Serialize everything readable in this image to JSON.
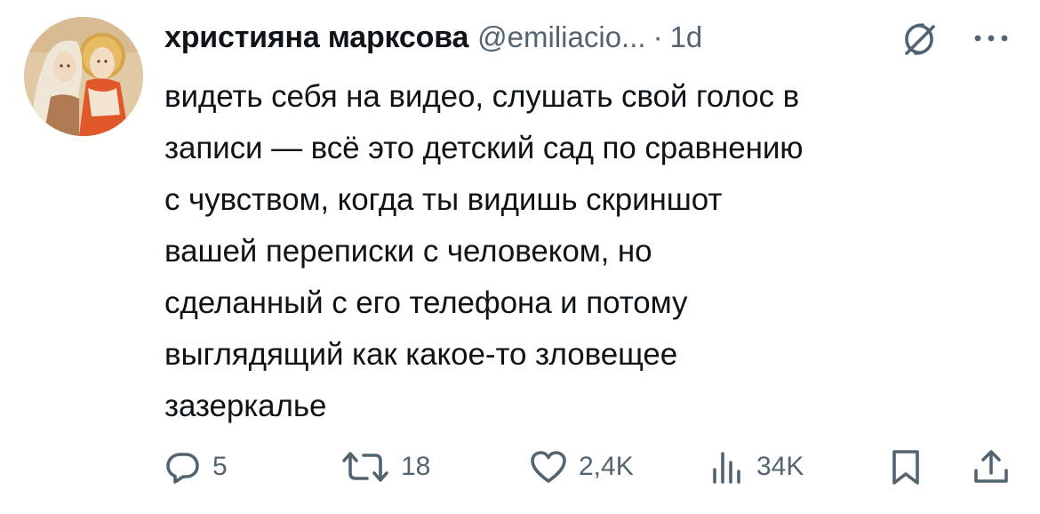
{
  "tweet": {
    "author": {
      "display_name": "християна марксова",
      "handle": "@emiliacio...",
      "separator": "·",
      "time": "1d"
    },
    "text": "видеть себя на видео, слушать свой голос в\nзаписи — всё это детский сад по сравнению\nс чувством, когда ты видишь скриншот\nвашей переписки с человеком, но\nсделанный с его телефона и потому\nвыглядящий как какое-то зловещее\nзазеркалье",
    "actions": {
      "replies": "5",
      "reposts": "18",
      "likes": "2,4K",
      "views": "34K"
    }
  },
  "icons": {
    "grok": "grok-icon",
    "more": "more-icon",
    "reply": "reply-icon",
    "repost": "repost-icon",
    "like": "heart-icon",
    "views": "views-icon",
    "bookmark": "bookmark-icon",
    "share": "share-icon"
  },
  "colors": {
    "text_primary": "#0f1419",
    "text_secondary": "#536471"
  }
}
